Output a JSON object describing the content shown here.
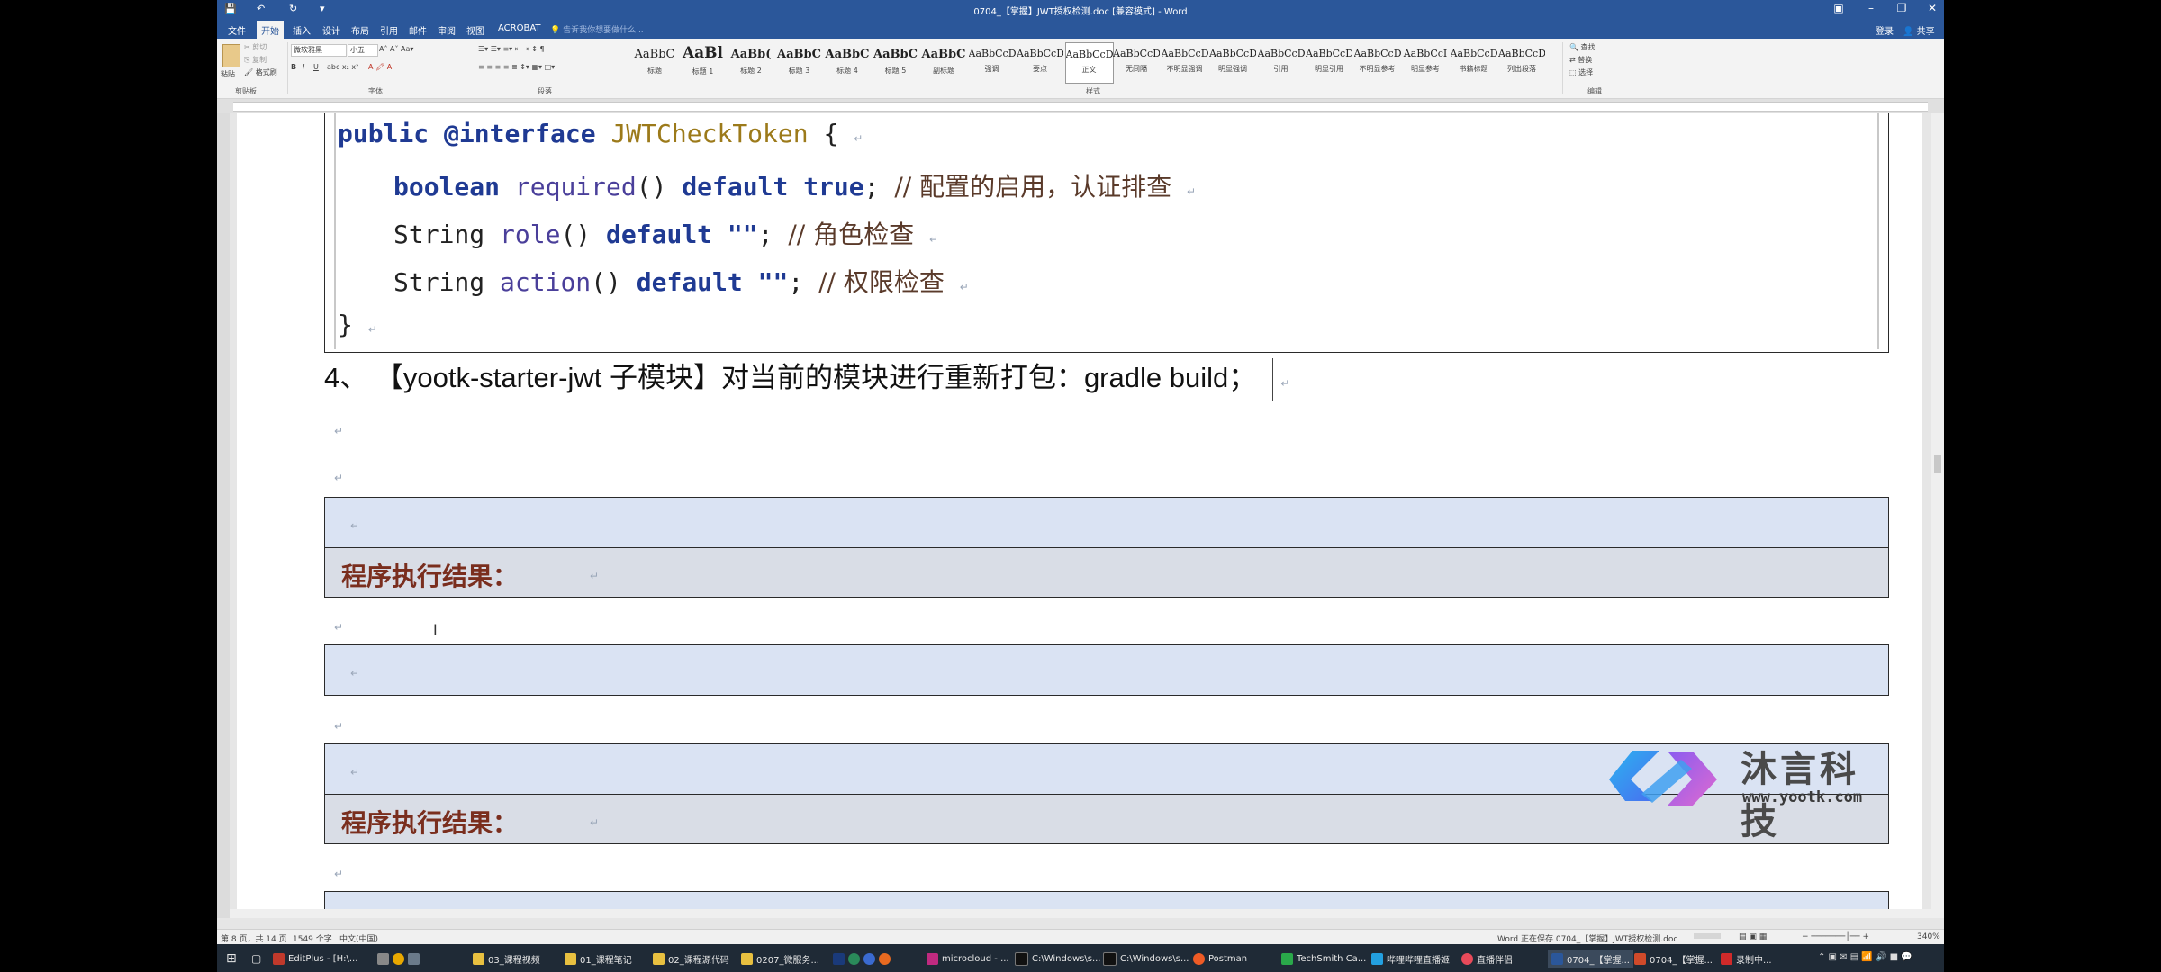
{
  "window": {
    "title": "0704_【掌握】JWT授权检测.doc [兼容模式] - Word",
    "sign_in": "登录",
    "share": "共享"
  },
  "menu": {
    "items": [
      "文件",
      "开始",
      "插入",
      "设计",
      "布局",
      "引用",
      "邮件",
      "审阅",
      "视图",
      "ACROBAT"
    ],
    "active": "开始",
    "search_placeholder": "告诉我你想要做什么..."
  },
  "ribbon": {
    "clipboard": {
      "paste": "粘贴",
      "cut": "剪切",
      "copy": "复制",
      "format_painter": "格式刷",
      "label": "剪贴板"
    },
    "font": {
      "name": "微软雅黑",
      "size": "小五",
      "label": "字体"
    },
    "paragraph": {
      "label": "段落"
    },
    "styles": {
      "label": "样式",
      "tiles": [
        {
          "sample": "AaBbC",
          "name": "标题"
        },
        {
          "sample": "AaBl",
          "name": "标题 1"
        },
        {
          "sample": "AaBb(",
          "name": "标题 2"
        },
        {
          "sample": "AaBbC",
          "name": "标题 3"
        },
        {
          "sample": "AaBbC",
          "name": "标题 4"
        },
        {
          "sample": "AaBbC",
          "name": "标题 5"
        },
        {
          "sample": "AaBbC",
          "name": "副标题"
        },
        {
          "sample": "AaBbCcDt",
          "name": "强调"
        },
        {
          "sample": "AaBbCcD",
          "name": "要点"
        },
        {
          "sample": "AaBbCcDc",
          "name": "正文"
        },
        {
          "sample": "AaBbCcDc",
          "name": "无间隔"
        },
        {
          "sample": "AaBbCcDc",
          "name": "不明显强调"
        },
        {
          "sample": "AaBbCcDc",
          "name": "明显强调"
        },
        {
          "sample": "AaBbCcDc",
          "name": "引用"
        },
        {
          "sample": "AaBbCcDc",
          "name": "明显引用"
        },
        {
          "sample": "AaBbCcD",
          "name": "不明显参考"
        },
        {
          "sample": "AaBbCcI",
          "name": "明显参考"
        },
        {
          "sample": "AaBbCcD",
          "name": "书籍标题"
        },
        {
          "sample": "AaBbCcDc",
          "name": "列出段落"
        }
      ],
      "selected": "正文"
    },
    "editing": {
      "find": "查找",
      "replace": "替换",
      "select": "选择",
      "label": "编辑"
    }
  },
  "document": {
    "code": {
      "line1": {
        "kw": "public",
        "ann": "@interface",
        "type": "JWTCheckToken",
        "rest": " {"
      },
      "line2": {
        "type": "boolean",
        "fn": "required",
        "paren": "()",
        "kw": "default",
        "val": "true",
        "end": ";",
        "comment": "// 配置的启用，认证排查"
      },
      "line3": {
        "type": "String",
        "fn": "role",
        "paren": "()",
        "kw": "default",
        "val": "\"\"",
        "end": ";",
        "comment": "// 角色检查"
      },
      "line4": {
        "type": "String",
        "fn": "action",
        "paren": "()",
        "kw": "default",
        "val": "\"\"",
        "end": ";",
        "comment": "// 权限检查"
      },
      "line5": "}"
    },
    "step_text": "4、 【yootk-starter-jwt 子模块】对当前的模块进行重新打包：gradle build；",
    "result_label": "程序执行结果："
  },
  "watermark": {
    "name": "沐言科技",
    "url": "www.yootk.com"
  },
  "status": {
    "page": "第 8 页，共 14 页",
    "words": "1549 个字",
    "lang": "中文(中国)",
    "saving": "Word 正在保存 0704_【掌握】JWT授权检测.doc",
    "zoom": "340%"
  },
  "taskbar": {
    "items": [
      "EditPlus - [H:\\...",
      "03_课程视频",
      "01_课程笔记",
      "02_课程源代码",
      "0207_微服务...",
      "microcloud - ...",
      "C:\\Windows\\s...",
      "C:\\Windows\\s...",
      "Postman",
      "TechSmith Ca...",
      "哔哩哔哩直播姬",
      "直播伴侣",
      "0704_【掌握...",
      "0704_【掌握...",
      "录制中..."
    ]
  }
}
